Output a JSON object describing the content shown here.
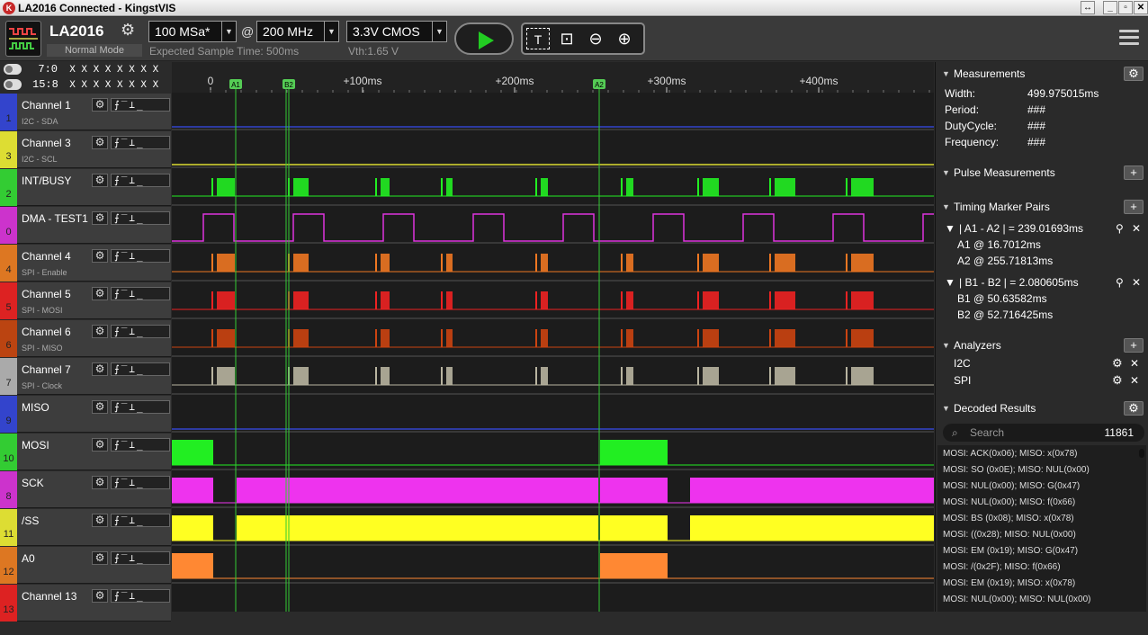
{
  "window": {
    "title": "LA2016 Connected - KingstVIS",
    "buttons": [
      "↔",
      "_",
      "▫",
      "✕"
    ]
  },
  "toolbar": {
    "device_name": "LA2016",
    "device_mode": "Normal Mode",
    "sample_rate": "100 MSa*",
    "at": "@",
    "frequency": "200 MHz",
    "voltage": "3.3V CMOS",
    "expected_time": "Expected Sample Time: 500ms",
    "vth": "Vth:1.65 V"
  },
  "bits": [
    {
      "label": "7:0",
      "value": "X X X X X X X X"
    },
    {
      "label": "15:8",
      "value": "X X X X X X X X"
    }
  ],
  "timeline": {
    "ticks": [
      "0",
      "+100ms",
      "+200ms",
      "+300ms",
      "+400ms"
    ],
    "markers": [
      "A1",
      "B2",
      "A2"
    ]
  },
  "channels": [
    {
      "num": "1",
      "name": "Channel 1",
      "sub": "I2C - SDA",
      "color": "#3344cc"
    },
    {
      "num": "3",
      "name": "Channel 3",
      "sub": "I2C - SCL",
      "color": "#dddd33"
    },
    {
      "num": "2",
      "name": "INT/BUSY",
      "sub": "",
      "color": "#33cc33"
    },
    {
      "num": "0",
      "name": "DMA - TEST1",
      "sub": "",
      "color": "#cc33cc"
    },
    {
      "num": "4",
      "name": "Channel 4",
      "sub": "SPI - Enable",
      "color": "#dd7722"
    },
    {
      "num": "5",
      "name": "Channel 5",
      "sub": "SPI - MOSI",
      "color": "#dd2222"
    },
    {
      "num": "6",
      "name": "Channel 6",
      "sub": "SPI - MISO",
      "color": "#bb4411"
    },
    {
      "num": "7",
      "name": "Channel 7",
      "sub": "SPI - Clock",
      "color": "#aaaaaa"
    },
    {
      "num": "9",
      "name": "MISO",
      "sub": "",
      "color": "#3344cc"
    },
    {
      "num": "10",
      "name": "MOSI",
      "sub": "",
      "color": "#33cc33"
    },
    {
      "num": "8",
      "name": "SCK",
      "sub": "",
      "color": "#cc33cc"
    },
    {
      "num": "11",
      "name": "/SS",
      "sub": "",
      "color": "#dddd33"
    },
    {
      "num": "12",
      "name": "A0",
      "sub": "",
      "color": "#dd7722"
    },
    {
      "num": "13",
      "name": "Channel 13",
      "sub": "",
      "color": "#dd2222"
    }
  ],
  "trigger_glyph": "⨍‾⊥_",
  "measurements": {
    "title": "Measurements",
    "rows": [
      {
        "k": "Width:",
        "v": "499.975015ms"
      },
      {
        "k": "Period:",
        "v": "###"
      },
      {
        "k": "DutyCycle:",
        "v": "###"
      },
      {
        "k": "Frequency:",
        "v": "###"
      }
    ]
  },
  "pulse": {
    "title": "Pulse Measurements"
  },
  "timing": {
    "title": "Timing Marker Pairs",
    "pairs": [
      {
        "head": "| A1 - A2 | = 239.01693ms",
        "a": "A1 @ 16.7012ms",
        "b": "A2 @ 255.71813ms"
      },
      {
        "head": "| B1 - B2 | = 2.080605ms",
        "a": "B1 @ 50.63582ms",
        "b": "B2 @ 52.716425ms"
      }
    ]
  },
  "analyzers": {
    "title": "Analyzers",
    "items": [
      "I2C",
      "SPI"
    ]
  },
  "decoded": {
    "title": "Decoded Results",
    "search_placeholder": "Search",
    "count": "11861",
    "rows": [
      "MOSI: ACK(0x06);  MISO: x(0x78)",
      "MOSI: SO (0x0E);  MISO: NUL(0x00)",
      "MOSI: NUL(0x00);  MISO: G(0x47)",
      "MOSI: NUL(0x00);  MISO: f(0x66)",
      "MOSI: BS (0x08);  MISO: x(0x78)",
      "MOSI: ((0x28);  MISO: NUL(0x00)",
      "MOSI: EM (0x19);  MISO: G(0x47)",
      "MOSI: /(0x2F);  MISO: f(0x66)",
      "MOSI: EM (0x19);  MISO: x(0x78)",
      "MOSI: NUL(0x00);  MISO: NUL(0x00)"
    ]
  }
}
